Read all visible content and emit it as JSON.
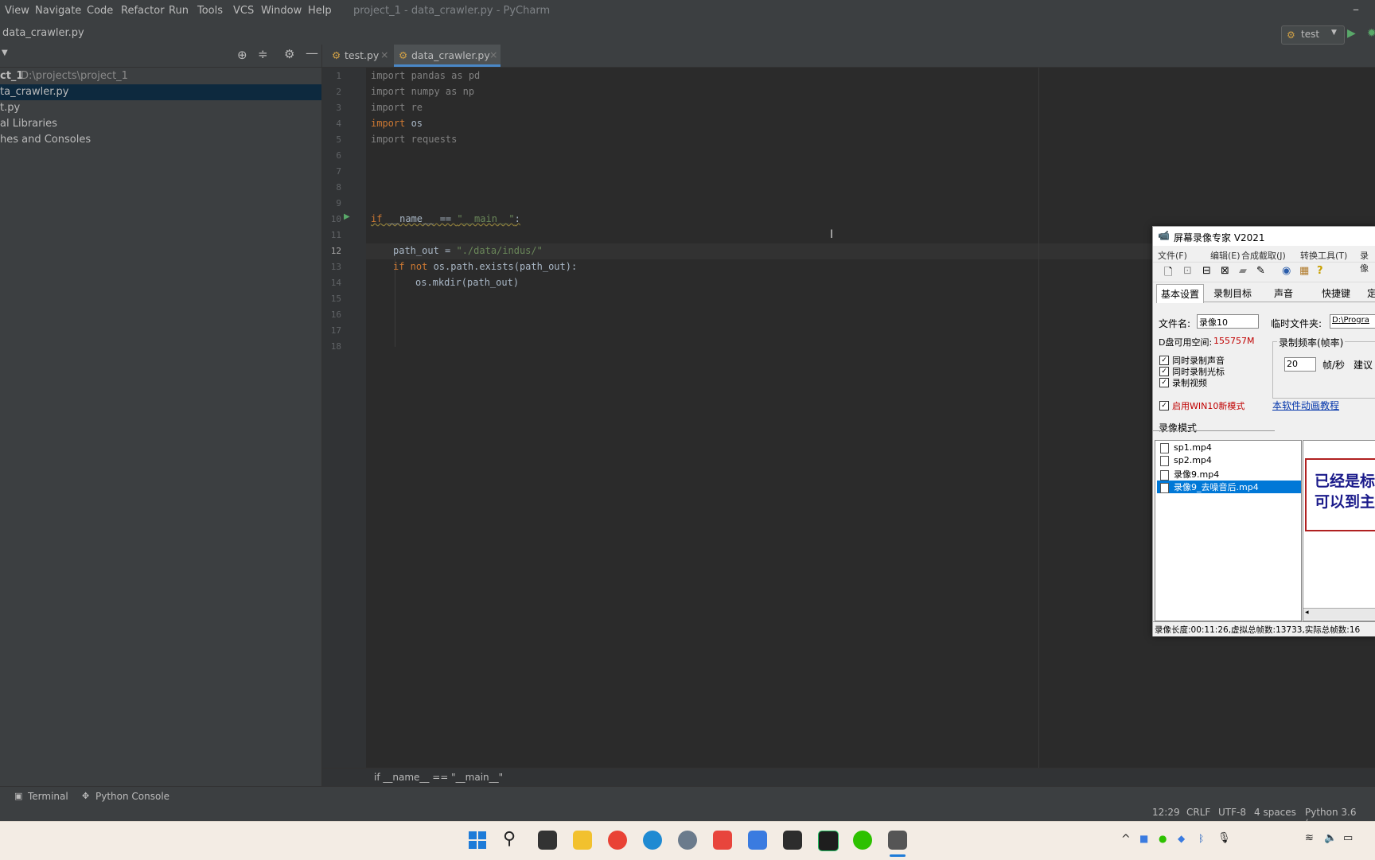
{
  "menu": [
    "View",
    "Navigate",
    "Code",
    "Refactor",
    "Run",
    "Tools",
    "VCS",
    "Window",
    "Help"
  ],
  "window_title": "project_1 - data_crawler.py - PyCharm",
  "nav": {
    "file": "data_crawler.py",
    "run_config": "test"
  },
  "project_tree": [
    {
      "name": "ct_1",
      "path": "D:\\projects\\project_1"
    },
    {
      "name": "ta_crawler.py",
      "selected": true
    },
    {
      "name": "t.py"
    },
    {
      "name": "al Libraries"
    },
    {
      "name": "hes and Consoles"
    }
  ],
  "tabs": [
    {
      "label": "test.py",
      "active": false
    },
    {
      "label": "data_crawler.py",
      "active": true
    }
  ],
  "code_lines": [
    "1",
    "2",
    "3",
    "4",
    "5",
    "6",
    "7",
    "8",
    "9",
    "10",
    "11",
    "12",
    "13",
    "14",
    "15",
    "16",
    "17",
    "18"
  ],
  "code": {
    "l1a": "import",
    "l1b": " pandas as pd",
    "l2a": "import",
    "l2b": " numpy as np",
    "l3a": "import",
    "l3b": " re",
    "l4a": "import",
    "l4b": " os",
    "l5a": "import",
    "l5b": " requests",
    "l10a": "if",
    "l10b": " __name__ == ",
    "l10c": "\"__main__\"",
    "l10d": ":",
    "l12a": "path_out = ",
    "l12b": "\"./data/indus/\"",
    "l13a": "if not",
    "l13b": " os.path.exists(path_out):",
    "l14": "os.mkdir(path_out)"
  },
  "breadcrumb": "if __name__ == \"__main__\"",
  "toolwindows": {
    "terminal": "Terminal",
    "python_console": "Python Console"
  },
  "status": {
    "position": "12:29",
    "line_sep": "CRLF",
    "encoding": "UTF-8",
    "indent": "4 spaces",
    "interpreter": "Python 3.6 (pro"
  },
  "recorder": {
    "title": "屏幕录像专家 V2021",
    "menu": [
      "文件(F)",
      "编辑(E)",
      "合成截取(J)",
      "转换工具(T)",
      "录像"
    ],
    "tabs": [
      "基本设置",
      "录制目标",
      "声音",
      "快捷键",
      "定"
    ],
    "filename_label": "文件名:",
    "filename_value": "录像10",
    "tempdir_label": "临时文件夹:",
    "tempdir_value": "D:\\Progra",
    "disk_label": "D盘可用空间:",
    "disk_value": "155757M",
    "fps_group": "录制频率(帧率)",
    "fps_value": "20",
    "fps_unit": "帧/秒",
    "fps_suggest": "建议",
    "checks": [
      "同时录制声音",
      "同时录制光标",
      "录制视频"
    ],
    "win10_mode": "启用WIN10新模式",
    "tutorial": "本软件动画教程",
    "mode_label": "录像模式",
    "files": [
      "sp1.mp4",
      "sp2.mp4",
      "录像9.mp4",
      "录像9_去噪音后.mp4"
    ],
    "preview_text_1": "已经是标",
    "preview_text_2": "可以到主",
    "status": "录像长度:00:11:26,虚拟总帧数:13733,实际总帧数:16"
  }
}
